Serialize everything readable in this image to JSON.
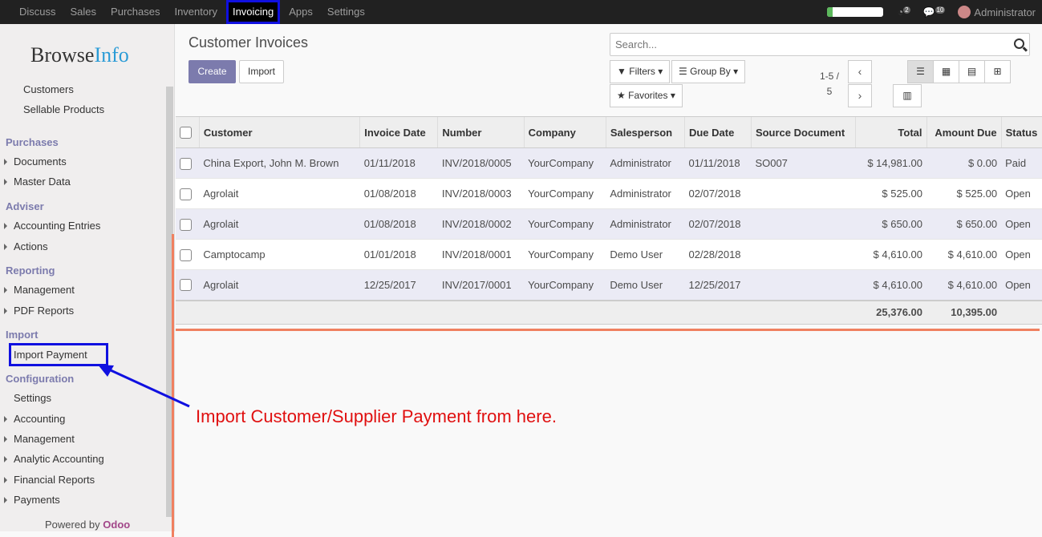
{
  "topmenu": [
    {
      "label": "Discuss",
      "active": false
    },
    {
      "label": "Sales",
      "active": false
    },
    {
      "label": "Purchases",
      "active": false
    },
    {
      "label": "Inventory",
      "active": false
    },
    {
      "label": "Invoicing",
      "active": true
    },
    {
      "label": "Apps",
      "active": false
    },
    {
      "label": "Settings",
      "active": false
    }
  ],
  "topright": {
    "progress_fraction": 0.1,
    "chat_count": "2",
    "activity_count": "10",
    "user": "Administrator"
  },
  "logo": {
    "part1": "Browse",
    "part2": "Info"
  },
  "sidebar": {
    "items": [
      {
        "label": "Customers",
        "type": "sub"
      },
      {
        "label": "Sellable Products",
        "type": "sub"
      },
      {
        "label": "Purchases",
        "type": "section"
      },
      {
        "label": "Documents",
        "type": "caret"
      },
      {
        "label": "Master Data",
        "type": "caret"
      },
      {
        "label": "Adviser",
        "type": "section"
      },
      {
        "label": "Accounting Entries",
        "type": "caret"
      },
      {
        "label": "Actions",
        "type": "caret"
      },
      {
        "label": "Reporting",
        "type": "section"
      },
      {
        "label": "Management",
        "type": "caret"
      },
      {
        "label": "PDF Reports",
        "type": "caret"
      },
      {
        "label": "Import",
        "type": "section"
      },
      {
        "label": "Import Payment",
        "type": "plain"
      },
      {
        "label": "Configuration",
        "type": "section"
      },
      {
        "label": "Settings",
        "type": "plain"
      },
      {
        "label": "Accounting",
        "type": "caret"
      },
      {
        "label": "Management",
        "type": "caret"
      },
      {
        "label": "Analytic Accounting",
        "type": "caret"
      },
      {
        "label": "Financial Reports",
        "type": "caret"
      },
      {
        "label": "Payments",
        "type": "caret"
      }
    ],
    "powered_prefix": "Powered by",
    "powered_brand": "Odoo"
  },
  "main": {
    "title": "Customer Invoices",
    "create_label": "Create",
    "import_label": "Import",
    "search_placeholder": "Search...",
    "filters_label": "Filters",
    "groupby_label": "Group By",
    "favorites_label": "Favorites",
    "pager_range": "1-5 /",
    "pager_total": "5"
  },
  "table": {
    "columns": [
      "Customer",
      "Invoice Date",
      "Number",
      "Company",
      "Salesperson",
      "Due Date",
      "Source Document",
      "Total",
      "Amount Due",
      "Status"
    ],
    "rows": [
      [
        "China Export, John M. Brown",
        "01/11/2018",
        "INV/2018/0005",
        "YourCompany",
        "Administrator",
        "01/11/2018",
        "SO007",
        "$ 14,981.00",
        "$ 0.00",
        "Paid"
      ],
      [
        "Agrolait",
        "01/08/2018",
        "INV/2018/0003",
        "YourCompany",
        "Administrator",
        "02/07/2018",
        "",
        "$ 525.00",
        "$ 525.00",
        "Open"
      ],
      [
        "Agrolait",
        "01/08/2018",
        "INV/2018/0002",
        "YourCompany",
        "Administrator",
        "02/07/2018",
        "",
        "$ 650.00",
        "$ 650.00",
        "Open"
      ],
      [
        "Camptocamp",
        "01/01/2018",
        "INV/2018/0001",
        "YourCompany",
        "Demo User",
        "02/28/2018",
        "",
        "$ 4,610.00",
        "$ 4,610.00",
        "Open"
      ],
      [
        "Agrolait",
        "12/25/2017",
        "INV/2017/0001",
        "YourCompany",
        "Demo User",
        "12/25/2017",
        "",
        "$ 4,610.00",
        "$ 4,610.00",
        "Open"
      ]
    ],
    "footer_total": "25,376.00",
    "footer_due": "10,395.00"
  },
  "annotation": {
    "text": "Import Customer/Supplier Payment from here.",
    "color": "#e01010"
  }
}
